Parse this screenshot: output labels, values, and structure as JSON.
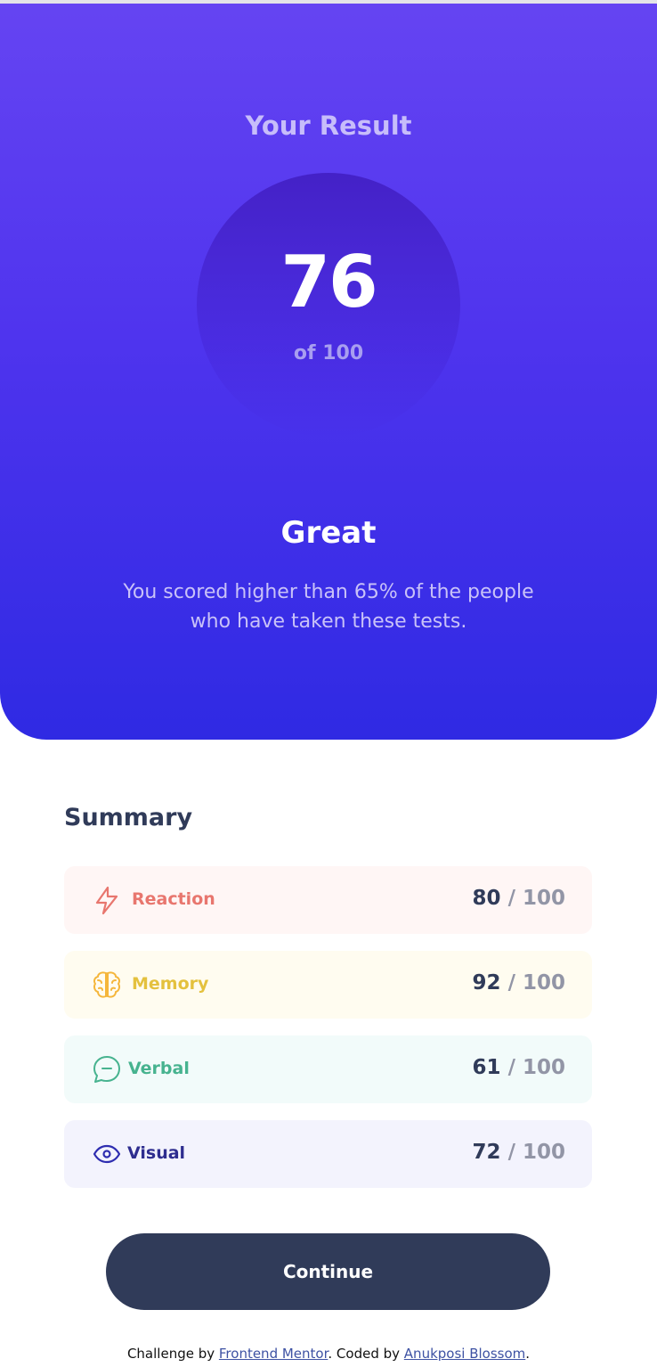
{
  "result": {
    "title": "Your Result",
    "score": "76",
    "out_of": "of 100",
    "rating": "Great",
    "description": "You scored higher than 65% of the people who have taken these tests."
  },
  "summary": {
    "title": "Summary",
    "items": [
      {
        "label": "Reaction",
        "score": "80",
        "total": "/ 100",
        "icon": "lightning-icon",
        "color": "#e8766e"
      },
      {
        "label": "Memory",
        "score": "92",
        "total": "/ 100",
        "icon": "brain-icon",
        "color": "#f5b63b"
      },
      {
        "label": "Verbal",
        "score": "61",
        "total": "/ 100",
        "icon": "chat-bubble-icon",
        "color": "#47b38f"
      },
      {
        "label": "Visual",
        "score": "72",
        "total": "/ 100",
        "icon": "eye-icon",
        "color": "#2e2db0"
      }
    ]
  },
  "continue_label": "Continue",
  "attribution": {
    "prefix": "Challenge by ",
    "link1": "Frontend Mentor",
    "middle": ". Coded by ",
    "link2": "Anukposi Blossom",
    "suffix": "."
  },
  "colors": {
    "gradient_top": "#6544f2",
    "gradient_bottom": "#2f2ae3",
    "dark_navy": "#303b59"
  }
}
